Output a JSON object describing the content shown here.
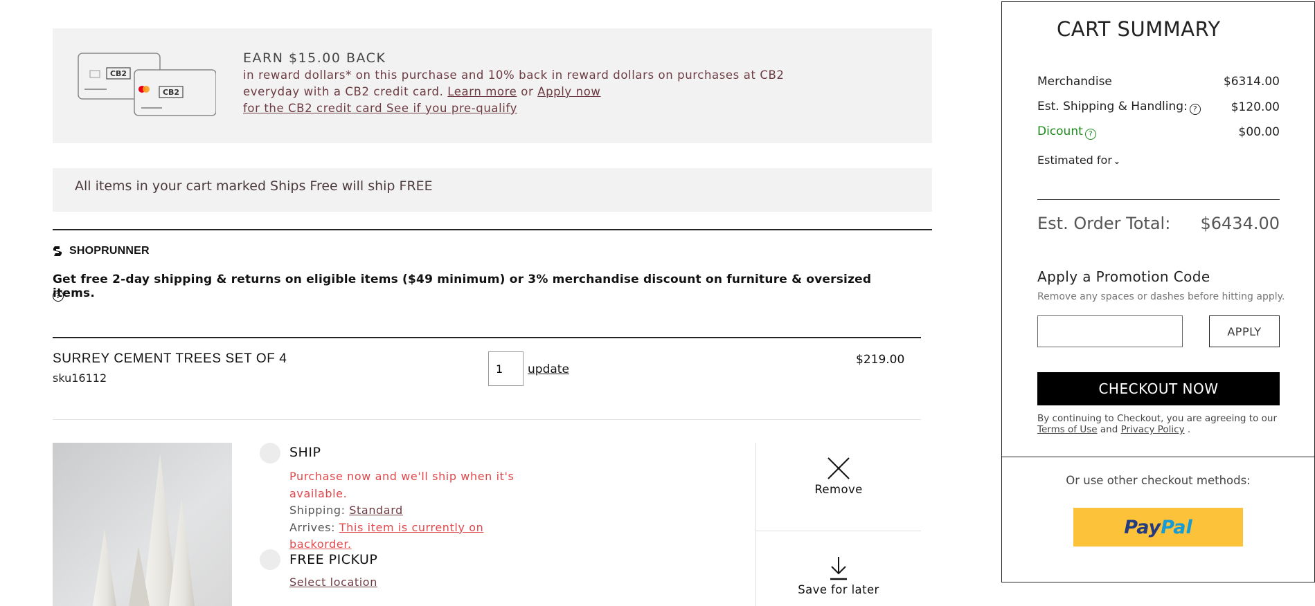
{
  "rewards_banner": {
    "card_brand": "CB2",
    "title": "EARN $15.00 BACK",
    "line1": "in reward dollars* on this purchase and 10% back in reward dollars on purchases at CB2",
    "line2_prefix": "everyday with a CB2 credit card.",
    "learn_more": "Learn more",
    "or": "or",
    "apply_now": "Apply now",
    "prequalify": "for the CB2 credit card See if you pre-qualify"
  },
  "free_ship_banner": {
    "text": "All items in your cart marked Ships Free will ship FREE"
  },
  "shoprunner": {
    "name": "SHOPRUNNER",
    "text": "Get free 2-day shipping & returns on eligible items ($49 minimum) or 3% merchandise discount on furniture & oversized items."
  },
  "cart_item": {
    "name": "SURREY CEMENT TREES SET OF 4",
    "sku": "sku16112",
    "quantity": "1",
    "update_label": "update",
    "price": "$219.00",
    "ship": {
      "title": "SHIP",
      "notice": "Purchase now and we'll ship when it's available.",
      "shipping_label": "Shipping:",
      "shipping_method": "Standard",
      "arrives_label": "Arrives:",
      "arrives_value": "This item is currently on backorder."
    },
    "pickup": {
      "title": "FREE PICKUP",
      "select_location": "Select location"
    },
    "actions": {
      "remove": "Remove",
      "save_for_later": "Save for later"
    }
  },
  "summary": {
    "title": "CART SUMMARY",
    "merchandise_label": "Merchandise",
    "merchandise_value": "$6314.00",
    "shipping_label": "Est. Shipping & Handling:",
    "shipping_value": "$120.00",
    "discount_label": "Dicount",
    "discount_value": "$00.00",
    "estimated_for": "Estimated for",
    "total_label": "Est. Order Total:",
    "total_value": "$6434.00",
    "promo_title": "Apply a Promotion Code",
    "promo_hint": "Remove any spaces or dashes before hitting apply.",
    "promo_value": "",
    "apply_label": "APPLY",
    "checkout_label": "CHECKOUT NOW",
    "legal_prefix": "By continuing to Checkout, you are agreeing to our",
    "terms": "Terms of Use",
    "and": "and",
    "privacy": "Privacy Policy",
    "period": "."
  },
  "alt_checkout": {
    "text": "Or use other checkout methods:",
    "paypal_a": "Pay",
    "paypal_b": "Pal"
  },
  "colors": {
    "banner_bg": "#f3f2f2",
    "alert_red": "#e0474b",
    "discount_green": "#1a8a1a",
    "paypal_yellow": "#fcc23a",
    "checkout_black": "#000000"
  },
  "icons": [
    "credit-card-icon",
    "shoprunner-logo-icon",
    "help-icon",
    "chevron-down-icon",
    "close-icon",
    "download-arrow-icon"
  ]
}
